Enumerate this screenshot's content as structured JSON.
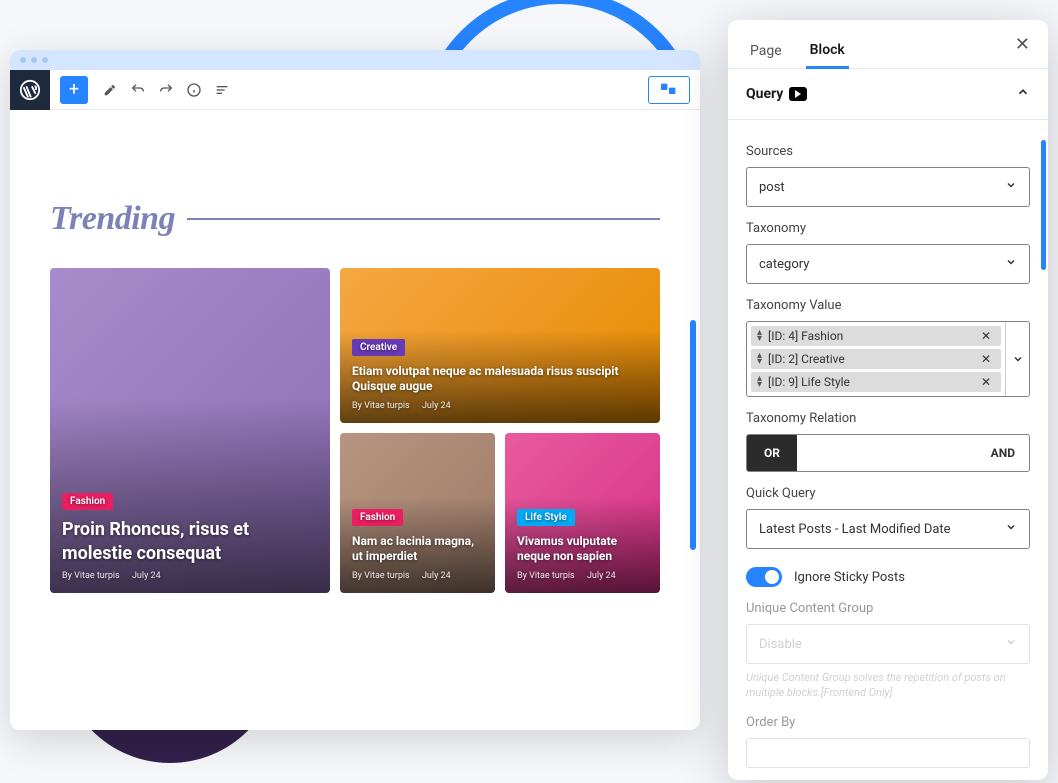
{
  "editor": {
    "heading": "Trending",
    "hero": {
      "tag": "Fashion",
      "title": "Proin Rhoncus, risus et molestie consequat",
      "author": "By Vitae turpis",
      "date": "July 24"
    },
    "topRight": {
      "tag": "Creative",
      "title": "Etiam volutpat neque ac malesuada risus suscipit Quisque augue",
      "author": "By Vitae turpis",
      "date": "July 24"
    },
    "bottom1": {
      "tag": "Fashion",
      "title": "Nam ac lacinia magna, ut imperdiet",
      "author": "By Vitae turpis",
      "date": "July 24"
    },
    "bottom2": {
      "tag": "Life Style",
      "title": "Vivamus vulputate neque non sapien",
      "author": "By Vitae turpis",
      "date": "July 24"
    }
  },
  "sidebar": {
    "tabs": {
      "page": "Page",
      "block": "Block"
    },
    "section": "Query",
    "labels": {
      "sources": "Sources",
      "taxonomy": "Taxonomy",
      "taxValue": "Taxonomy Value",
      "taxRelation": "Taxonomy Relation",
      "quickQuery": "Quick Query",
      "ignoreSticky": "Ignore Sticky Posts",
      "uniqueGroup": "Unique Content Group",
      "orderBy": "Order By"
    },
    "values": {
      "sources": "post",
      "taxonomy": "category",
      "quickQuery": "Latest Posts - Last Modified Date",
      "uniqueGroup": "Disable"
    },
    "taxItems": [
      {
        "label": "[ID: 4] Fashion"
      },
      {
        "label": "[ID: 2] Creative"
      },
      {
        "label": "[ID: 9] Life Style"
      }
    ],
    "relation": {
      "or": "OR",
      "and": "AND"
    },
    "hint": "Unique Content Group solves the repetition of posts on multiple blocks.[Frontend Only]"
  }
}
